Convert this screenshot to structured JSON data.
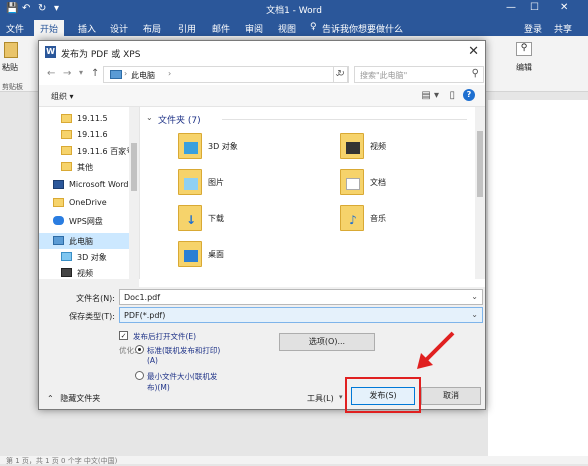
{
  "window": {
    "title": "文档1 - Word"
  },
  "ribbon_tabs": {
    "file": "文件",
    "home": "开始",
    "insert": "插入",
    "design": "设计",
    "layout": "布局",
    "references": "引用",
    "mailings": "邮件",
    "review": "审阅",
    "view": "视图",
    "tell_me": "告诉我你想要做什么",
    "login": "登录",
    "share": "共享"
  },
  "ribbon": {
    "paste": "粘贴",
    "clipboard": "剪贴板",
    "edit": "编辑"
  },
  "dialog": {
    "title": "发布为 PDF 或 XPS",
    "address": "此电脑",
    "search_placeholder": "搜索\"此电脑\"",
    "organize": "组织 ▾",
    "nav_items": [
      "19.11.5",
      "19.11.6",
      "19.11.6 百家号",
      "其他",
      "Microsoft Word",
      "OneDrive",
      "WPS网盘",
      "此电脑",
      "3D 对象",
      "视频"
    ],
    "group_header": "文件夹 (7)",
    "folders": [
      "3D 对象",
      "视频",
      "图片",
      "文档",
      "下载",
      "音乐",
      "桌面"
    ],
    "filename_label": "文件名(N):",
    "filename_value": "Doc1.pdf",
    "filetype_label": "保存类型(T):",
    "filetype_value": "PDF(*.pdf)",
    "open_after": "发布后打开文件(E)",
    "options_button": "选项(O)...",
    "optimize_label": "优化:",
    "opt_standard_1": "标准(联机发布和打印)",
    "opt_standard_2": "(A)",
    "opt_min_1": "最小文件大小(联机发",
    "opt_min_2": "布)(M)",
    "hide_folders": "隐藏文件夹",
    "tools": "工具(L)",
    "publish": "发布(S)",
    "cancel": "取消"
  },
  "status": {
    "text": "第 1 页，共 1 页    0 个字    中文(中国)"
  },
  "colors": {
    "word_blue": "#2b579a",
    "highlight_red": "#e02020"
  }
}
